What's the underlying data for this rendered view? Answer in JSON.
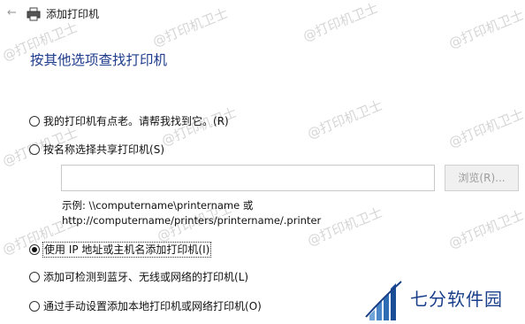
{
  "window": {
    "title": "添加打印机"
  },
  "heading": "按其他选项查找打印机",
  "options": [
    {
      "label": "我的打印机有点老。请帮我找到它。",
      "key": "(R)",
      "checked": false
    },
    {
      "label": "按名称选择共享打印机",
      "key": "(S)",
      "checked": false
    },
    {
      "label": "使用 IP 地址或主机名添加打印机",
      "key": "(I)",
      "checked": true
    },
    {
      "label": "添加可检测到蓝牙、无线或网络的打印机",
      "key": "(L)",
      "checked": false
    },
    {
      "label": "通过手动设置添加本地打印机或网络打印机",
      "key": "(O)",
      "checked": false
    }
  ],
  "shared": {
    "input_value": "",
    "browse_label": "浏览(R)...",
    "example_line1": "示例: \\\\computername\\printername 或",
    "example_line2": "http://computername/printers/printername/.printer"
  },
  "watermark": "@打印机卫士",
  "brand": {
    "name": "七分软件园"
  },
  "colors": {
    "heading": "#1f3d8c",
    "brand": "#1a3f8a",
    "watermark": "#d6d6d6"
  }
}
